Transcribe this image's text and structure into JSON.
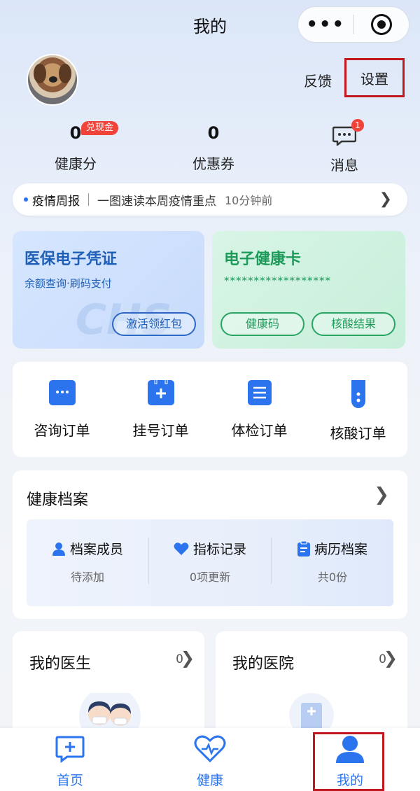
{
  "header": {
    "title": "我的",
    "menu_icon": "more-dots-icon",
    "close_icon": "target-icon"
  },
  "profile": {
    "feedback": "反馈",
    "settings": "设置"
  },
  "stats": [
    {
      "value": "0",
      "label": "健康分",
      "badge": "兑现金"
    },
    {
      "value": "0",
      "label": "优惠券"
    }
  ],
  "messages": {
    "label": "消息",
    "badge": "1"
  },
  "epidemic": {
    "title": "疫情周报",
    "text": "一图速读本周疫情重点",
    "time": "10分钟前"
  },
  "insurance_card": {
    "title": "医保电子凭证",
    "sub": "余额查询·刷码支付",
    "button": "激活领红包"
  },
  "health_card": {
    "title": "电子健康卡",
    "masked": "******************",
    "btn1": "健康码",
    "btn2": "核酸结果"
  },
  "orders": [
    {
      "label": "咨询订单",
      "icon": "chat-icon"
    },
    {
      "label": "挂号订单",
      "icon": "calendar-plus-icon"
    },
    {
      "label": "体检订单",
      "icon": "document-list-icon"
    },
    {
      "label": "核酸订单",
      "icon": "test-tube-icon"
    }
  ],
  "archive": {
    "title": "健康档案",
    "items": [
      {
        "label": "档案成员",
        "value": "待添加",
        "icon": "person-icon"
      },
      {
        "label": "指标记录",
        "value": "0项更新",
        "icon": "heart-icon"
      },
      {
        "label": "病历档案",
        "value": "共0份",
        "icon": "clipboard-icon"
      }
    ]
  },
  "my_doctor": {
    "title": "我的医生",
    "count": "0"
  },
  "my_hospital": {
    "title": "我的医院",
    "count": "0"
  },
  "tabs": [
    {
      "label": "首页",
      "icon": "chat-plus-icon"
    },
    {
      "label": "健康",
      "icon": "heart-pulse-icon"
    },
    {
      "label": "我的",
      "icon": "person-icon"
    }
  ],
  "colors": {
    "accent": "#2b74ee",
    "badge": "#f0433a",
    "highlight": "#c0181e",
    "insurance": "#1f5fb8",
    "health": "#1e9a5a"
  }
}
